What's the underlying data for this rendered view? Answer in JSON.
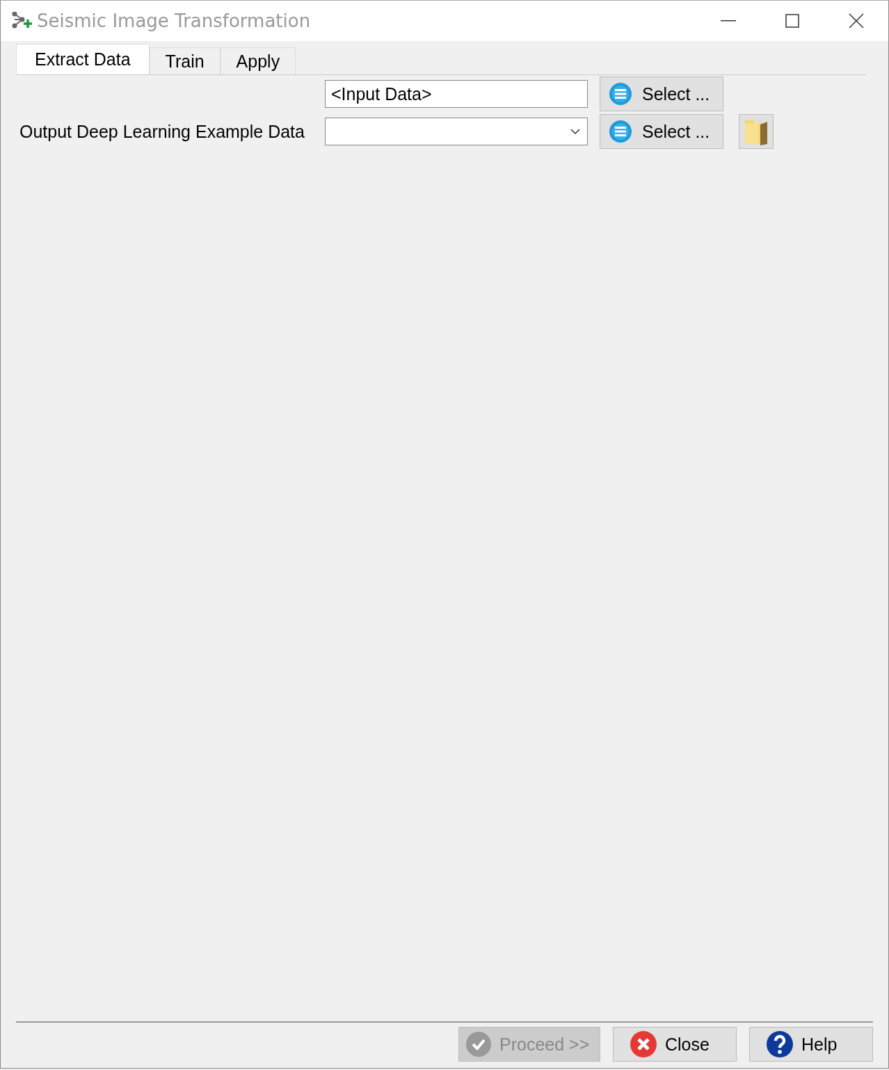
{
  "window": {
    "title": "Seismic Image Transformation"
  },
  "tabs": [
    {
      "label": "Extract Data",
      "selected": true
    },
    {
      "label": "Train",
      "selected": false
    },
    {
      "label": "Apply",
      "selected": false
    }
  ],
  "rows": [
    {
      "kind": "text",
      "value": "<Input Data>",
      "select": "Select ...",
      "folder": false
    },
    {
      "kind": "dropdown",
      "label": "Output Deep Learning Example Data",
      "select": "Select ...",
      "folder": true
    }
  ],
  "buttons": [
    {
      "kind": "proceed",
      "label": "Proceed >>",
      "disabled": true
    },
    {
      "kind": "close",
      "label": "Close",
      "disabled": false
    },
    {
      "kind": "help",
      "label": "Help",
      "disabled": false
    }
  ]
}
